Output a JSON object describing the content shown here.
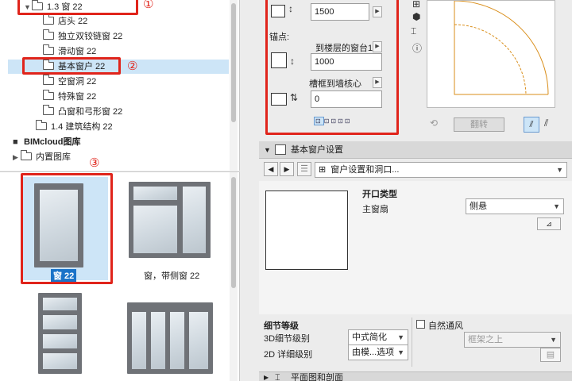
{
  "tree": {
    "root_folder": "1.3 窗 22",
    "items": [
      "店头 22",
      "独立双铰链窗 22",
      "滑动窗 22",
      "基本窗户 22",
      "空窗洞 22",
      "特殊窗 22",
      "凸窗和弓形窗 22"
    ],
    "sibling_folder": "1.4 建筑结构 22",
    "libraries": [
      "BIMcloud图库",
      "内置图库"
    ]
  },
  "callouts": [
    "①",
    "②",
    "③"
  ],
  "thumbnails": [
    {
      "label": "窗 22"
    },
    {
      "label": "窗，带侧窗 22"
    }
  ],
  "params": {
    "height_value": "1500",
    "anchor_label": "锚点:",
    "anchor_ref": "到楼层的窗台1",
    "sill_value": "1000",
    "reveal_label": "槽框到墙核心",
    "reveal_value": "0",
    "mirror_button": "翻转"
  },
  "section": {
    "title": "基本窗户设置",
    "subpanel": "窗户设置和洞口...",
    "opening_type_heading": "开口类型",
    "main_sash_label": "主窗扇",
    "main_sash_value": "侧悬"
  },
  "detail": {
    "heading": "细节等级",
    "row3d_label": "3D细节级别",
    "row3d_value": "中式简化",
    "row2d_label": "2D 详细级别",
    "row2d_value": "由模...选项",
    "natural_vent_label": "自然通风",
    "vent_dropdown": "框架之上"
  },
  "bottom_section": "平面图和剖面",
  "colors": {
    "highlight": "#e0241b",
    "selection": "#cde5f7",
    "accent_blue": "#1a73c8"
  }
}
